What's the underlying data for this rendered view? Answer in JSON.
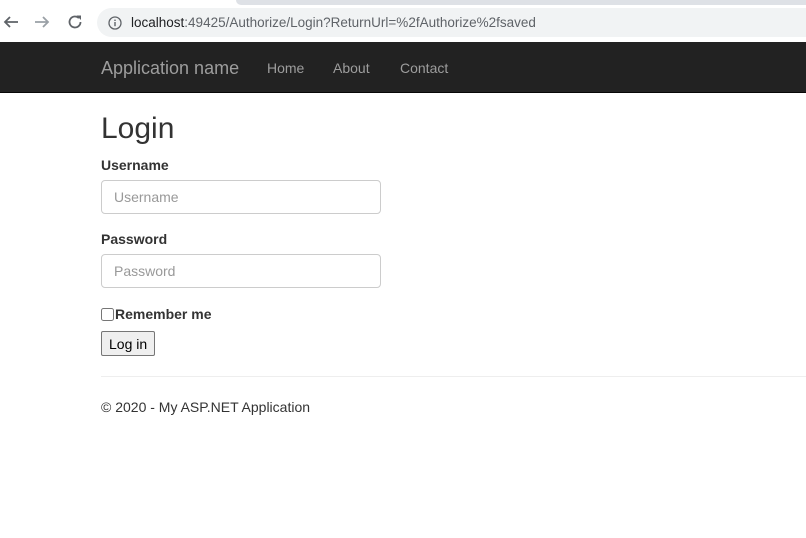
{
  "browser": {
    "url_host": "localhost",
    "url_rest": ":49425/Authorize/Login?ReturnUrl=%2fAuthorize%2fsaved",
    "back_icon": "arrow-left-icon",
    "forward_icon": "arrow-right-icon",
    "reload_icon": "reload-icon",
    "info_icon": "info-icon"
  },
  "navbar": {
    "brand": "Application name",
    "links": [
      "Home",
      "About",
      "Contact"
    ],
    "background": "#222222",
    "link_color": "#9d9d9d"
  },
  "login": {
    "title": "Login",
    "username_label": "Username",
    "username_placeholder": "Username",
    "username_value": "",
    "password_label": "Password",
    "password_placeholder": "Password",
    "password_value": "",
    "remember_label": "Remember me",
    "remember_checked": false,
    "submit_label": "Log in"
  },
  "footer": {
    "text": "© 2020 - My ASP.NET Application"
  }
}
